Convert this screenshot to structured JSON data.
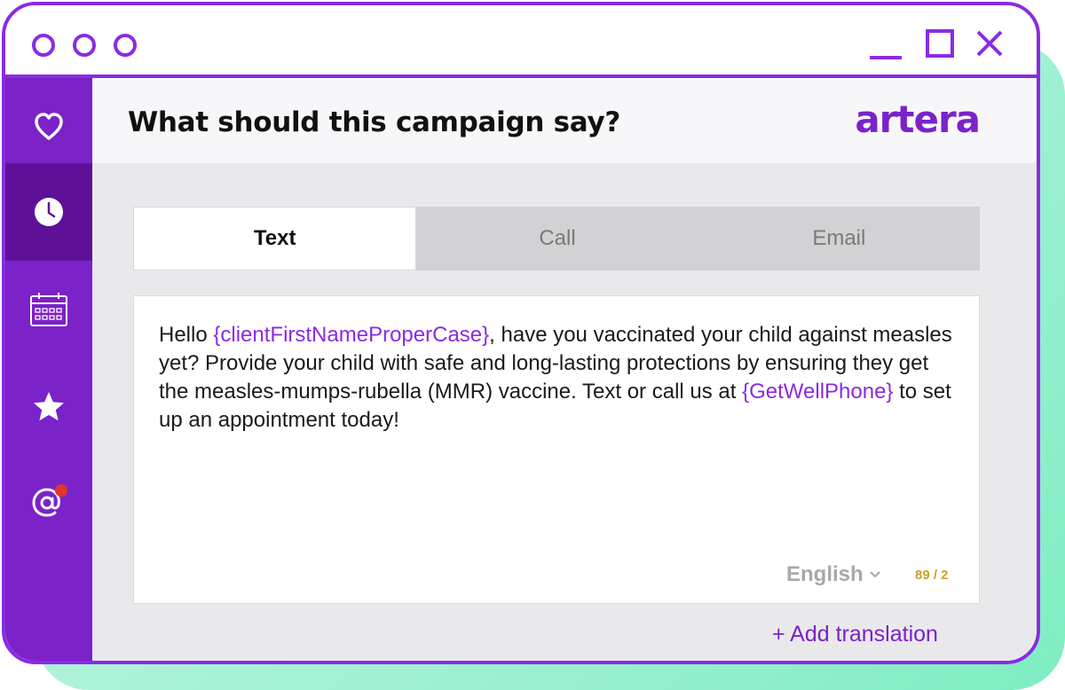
{
  "header": {
    "title": "What should this campaign say?",
    "logo_text": "artera"
  },
  "sidebar": {
    "items": [
      {
        "icon": "heart-icon",
        "active": false
      },
      {
        "icon": "clock-icon",
        "active": true
      },
      {
        "icon": "calendar-icon",
        "active": false
      },
      {
        "icon": "star-icon",
        "active": false
      },
      {
        "icon": "at-sign-icon",
        "active": false,
        "notification_dot": true
      }
    ]
  },
  "tabs": [
    {
      "label": "Text",
      "active": true
    },
    {
      "label": "Call",
      "active": false
    },
    {
      "label": "Email",
      "active": false
    }
  ],
  "message": {
    "part1": "Hello ",
    "var1": "{clientFirstNameProperCase}",
    "part2": ", have you vaccinated your child against measles yet? Provide your child with safe and long-lasting protections by ensuring they get the measles-mumps-rubella (MMR) vaccine. Text or call us at ",
    "var2": "{GetWellPhone}",
    "part3": " to set up an appointment today!"
  },
  "language": {
    "selected": "English"
  },
  "char_count": "89 / 2",
  "add_translation_label": "+ Add translation",
  "colors": {
    "brand_purple": "#7b22c9",
    "border_purple": "#8a2be2",
    "sidebar_active": "#5e1198",
    "count_gold": "#c9a227",
    "notification_red": "#e0352b"
  }
}
